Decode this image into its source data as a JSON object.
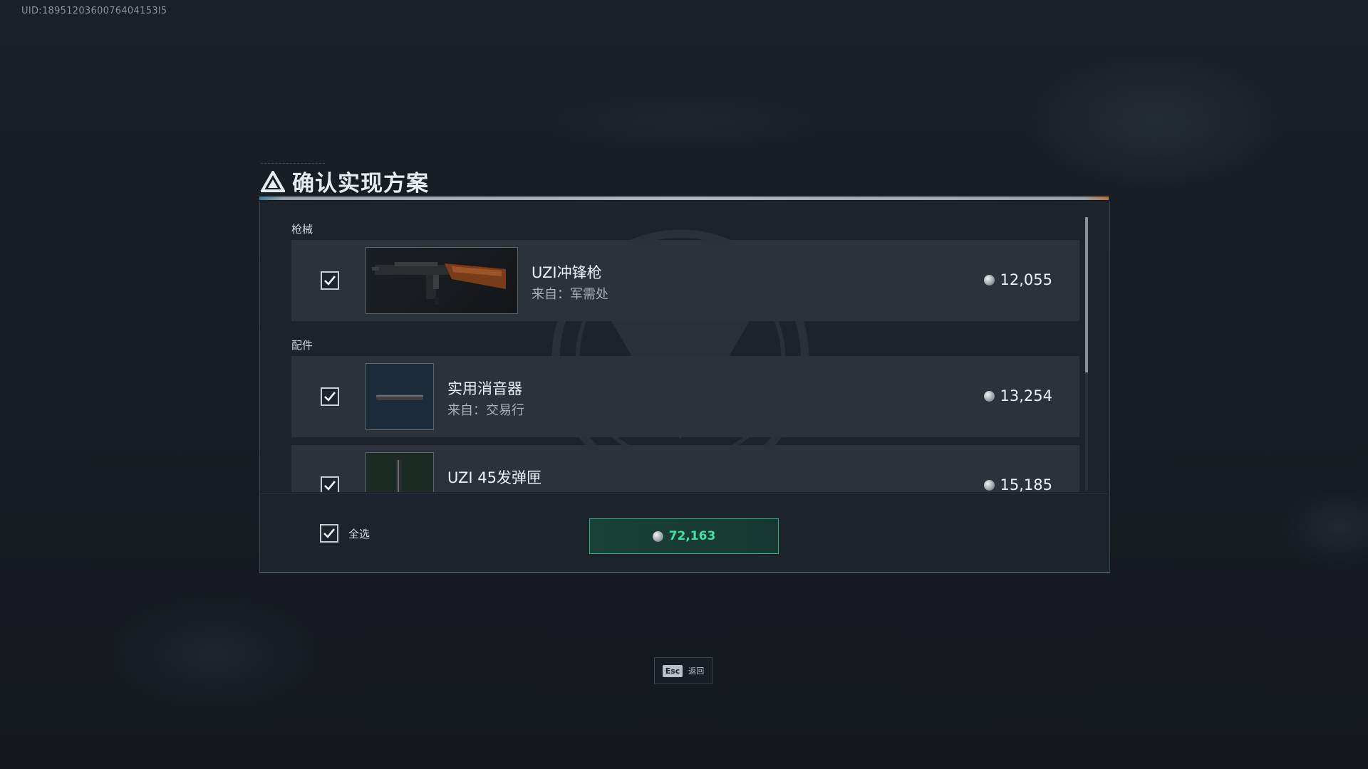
{
  "uid": "UID:1895120360076404153l5",
  "dialog": {
    "title": "确认实现方案"
  },
  "sections": {
    "weapons_label": "枪械",
    "attachments_label": "配件"
  },
  "items": [
    {
      "name": "UZI冲锋枪",
      "source": "来自：军需处",
      "price": "12,055",
      "checked": true
    },
    {
      "name": "实用消音器",
      "source": "来自：交易行",
      "price": "13,254",
      "checked": true
    },
    {
      "name": "UZI 45发弹匣",
      "source": "",
      "price": "15,185",
      "checked": true
    }
  ],
  "footer": {
    "select_all_label": "全选",
    "total": "72,163"
  },
  "esc_hint": {
    "key": "Esc",
    "label": "返回"
  },
  "colors": {
    "accent_green": "#3fe2a2",
    "panel_bg": "#1e242b",
    "row_bg": "#2b323a"
  },
  "icons": [
    "warning-triangle-icon",
    "check-icon",
    "coin-icon",
    "uzi-weapon-image",
    "suppressor-image",
    "magazine-image"
  ]
}
